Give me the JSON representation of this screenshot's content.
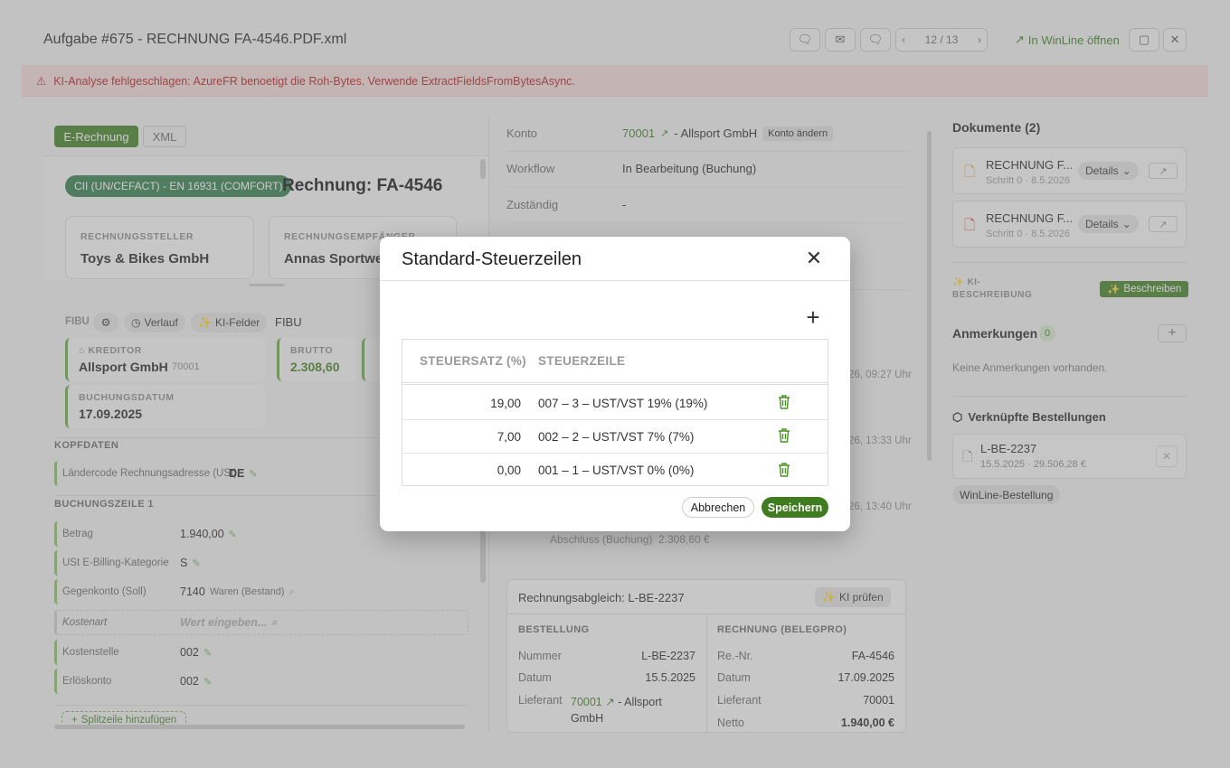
{
  "header": {
    "title": "Aufgabe #675 - RECHNUNG FA-4546.PDF.xml",
    "pager": "12 / 13",
    "winline_link": "In WinLine öffnen"
  },
  "error_bar": {
    "message": "KI-Analyse fehlgeschlagen: AzureFR benoetigt die Roh-Bytes. Verwende ExtractFieldsFromBytesAsync."
  },
  "left_panel": {
    "tabs": [
      "E-Rechnung",
      "XML"
    ],
    "format_badge": "CII (UN/CEFACT) - EN 16931 (COMFORT)",
    "invoice_heading": "Rechnung: FA-4546",
    "seller_label": "RECHNUNGSSTELLER",
    "seller_name": "Toys & Bikes GmbH",
    "buyer_label": "RECHNUNGSEMPFÄNGER",
    "buyer_name": "Annas Sportwel",
    "fibu_label": "FIBU",
    "fibu_buttons": [
      "Verlauf",
      "KI-Felder"
    ],
    "fibu_tab": "FIBU",
    "kreditor_label": "KREDITOR",
    "kreditor_name": "Allsport GmbH",
    "kreditor_nr": "70001",
    "brutto_label": "BRUTTO",
    "brutto_value": "2.308,60",
    "buchungsdatum_label": "BUCHUNGSDATUM",
    "buchungsdatum_value": "17.09.2025",
    "kopfdaten_label": "KOPFDATEN",
    "laendercode_label": "Ländercode Rechnungsadresse (USt)",
    "laendercode_value": "DE",
    "buchungszeile_label": "BUCHUNGSZEILE 1",
    "fields": [
      {
        "label": "Betrag",
        "value": "1.940,00"
      },
      {
        "label": "USt E-Billing-Kategorie",
        "value": "S"
      },
      {
        "label": "Gegenkonto (Soll)",
        "value": "7140",
        "extra": "Waren (Bestand)"
      },
      {
        "label": "Kostenart",
        "placeholder": "Wert eingeben..."
      },
      {
        "label": "Kostenstelle",
        "value": "002"
      },
      {
        "label": "Erlöskonto",
        "value": "002"
      }
    ],
    "split_button": "Splitzeile hinzufügen"
  },
  "middle_panel": {
    "konto_label": "Konto",
    "konto_nr": "70001",
    "konto_name": "- Allsport GmbH",
    "konto_change": "Konto ändern",
    "workflow_label": "Workflow",
    "workflow_value": "In Bearbeitung (Buchung)",
    "zustaendig_label": "Zuständig",
    "zustaendig_value": "-",
    "timestamps": [
      "26, 09:27 Uhr",
      "26, 13:33 Uhr",
      "26, 13:40 Uhr"
    ],
    "abschluss_label": "Abschluss (Buchung)",
    "abschluss_value": "2.308,60 €",
    "abgleich_title": "Rechnungsabgleich: L-BE-2237",
    "ki_pruefen": "KI prüfen",
    "bestellung_header": "BESTELLUNG",
    "rechnung_header": "RECHNUNG (BELEGPRO)",
    "bestellung_rows": [
      {
        "k": "Nummer",
        "v": "L-BE-2237"
      },
      {
        "k": "Datum",
        "v": "15.5.2025"
      },
      {
        "k": "Lieferant",
        "v": "70001",
        "v2": "- Allsport",
        "v3": "GmbH"
      }
    ],
    "rechnung_rows": [
      {
        "k": "Re.-Nr.",
        "v": "FA-4546"
      },
      {
        "k": "Datum",
        "v": "17.09.2025"
      },
      {
        "k": "Lieferant",
        "v": "70001"
      },
      {
        "k": "Netto",
        "v": "1.940,00 €"
      }
    ]
  },
  "right_panel": {
    "documents_title": "Dokumente (2)",
    "documents": [
      {
        "name": "RECHNUNG F...",
        "meta": "Schritt 0 · 8.5.2026",
        "details": "Details",
        "icon": "file-icon",
        "color": "#e0a030"
      },
      {
        "name": "RECHNUNG F...",
        "meta": "Schritt 0 · 8.5.2026",
        "details": "Details",
        "icon": "pdf-icon",
        "color": "#d03030"
      }
    ],
    "ki_label_1": "KI-",
    "ki_label_2": "BESCHREIBUNG",
    "beschreiben": "Beschreiben",
    "anmerkungen_title": "Anmerkungen",
    "anmerkungen_count": "0",
    "anmerkungen_empty": "Keine Anmerkungen vorhanden.",
    "bestellungen_title": "Verknüpfte Bestellungen",
    "bestellung_nr": "L-BE-2237",
    "bestellung_meta": "15.5.2025 · 29.506,28 €",
    "winline_tag": "WinLine-Bestellung"
  },
  "modal": {
    "title": "Standard-Steuerzeilen",
    "col_rate": "STEUERSATZ (%)",
    "col_line": "STEUERZEILE",
    "rows": [
      {
        "rate": "19,00",
        "line": "007 – 3 – UST/VST 19% (19%)"
      },
      {
        "rate": "7,00",
        "line": "002 – 2 – UST/VST 7% (7%)"
      },
      {
        "rate": "0,00",
        "line": "001 – 1 – UST/VST 0% (0%)"
      }
    ],
    "cancel": "Abbrechen",
    "save": "Speichern"
  },
  "colors": {
    "accent": "#3f7c1f",
    "error": "#b01c1c"
  }
}
